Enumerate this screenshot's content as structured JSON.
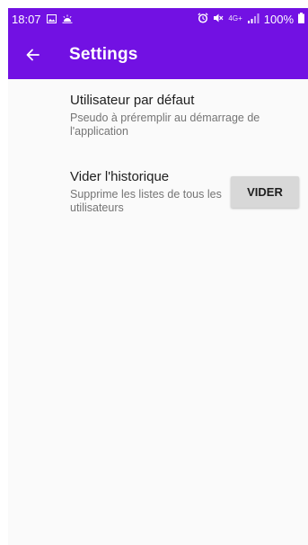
{
  "status_bar": {
    "time": "18:07",
    "battery": "100%",
    "signal_label": "4G+",
    "icons": [
      "image-icon",
      "weather-icon",
      "alarm-icon",
      "mute-icon",
      "signal-icon",
      "battery-icon"
    ]
  },
  "app_bar": {
    "title": "Settings",
    "back_icon": "arrow-left-icon"
  },
  "preferences": [
    {
      "title": "Utilisateur par défaut",
      "summary": "Pseudo à préremplir au démarrage de l'application"
    },
    {
      "title": "Vider l'historique",
      "summary": "Supprime les listes de tous les utilisateurs",
      "button_label": "VIDER"
    }
  ],
  "colors": {
    "primary": "#7211e3",
    "background": "#fafafa",
    "button": "#d8d8d8"
  }
}
